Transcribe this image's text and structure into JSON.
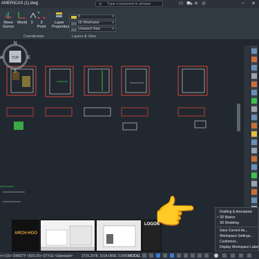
{
  "titlebar": {
    "filename": "AMERICAS (1).dwg",
    "search_placeholder": "Type a keyword or phrase",
    "icons": [
      "search-icon",
      "user-icon",
      "cart-icon",
      "exchange-icon",
      "help-icon",
      "minimize-icon",
      "close-icon"
    ]
  },
  "ribbon": {
    "buttons": [
      {
        "label": "Move\nGizmo",
        "icon": "move-gizmo-icon"
      },
      {
        "label": "World",
        "icon": "world-icon"
      },
      {
        "label": "3\nPoint",
        "icon": "three-point-icon"
      },
      {
        "label": "Layer\nProperties",
        "icon": "layer-properties-icon"
      }
    ],
    "panels": {
      "coordinates": "Coordinates",
      "layers_view": "Layers & View"
    },
    "layer_combo": "0",
    "visual_style_combo": "2D Wireframe",
    "view_combo": "Unsaved View"
  },
  "viewcube": {
    "top": "TOP",
    "n": "N",
    "s": "S",
    "e": "E",
    "w": "W"
  },
  "thumbnail_logo": "ARCH-HOO",
  "thumbnail_logo2": "LOGON",
  "context_menu": {
    "items": [
      {
        "label": "Drafting & Annotation",
        "checked": false
      },
      {
        "label": "3D Basics",
        "checked": true
      },
      {
        "label": "3D Modeling",
        "checked": false
      },
      {
        "label": "Save Current As...",
        "checked": false
      },
      {
        "label": "Workspace Settings...",
        "checked": false
      },
      {
        "label": "Customize...",
        "checked": false
      },
      {
        "label": "Display Workspace Label",
        "checked": false
      }
    ]
  },
  "statusbar": {
    "command": "<<<15> DIMSTY <ISO-25> STYLE <Standard>",
    "coordinates": "3725.2978, 1014.0608, 0.0000",
    "model": "MODEL"
  },
  "colors": {
    "background": "#212830",
    "ribbon": "#313943",
    "drawing_red": "#d9463a",
    "drawing_green": "#3fc04a",
    "drawing_white": "#e8e8e8",
    "accent_blue": "#3a7bd5"
  }
}
